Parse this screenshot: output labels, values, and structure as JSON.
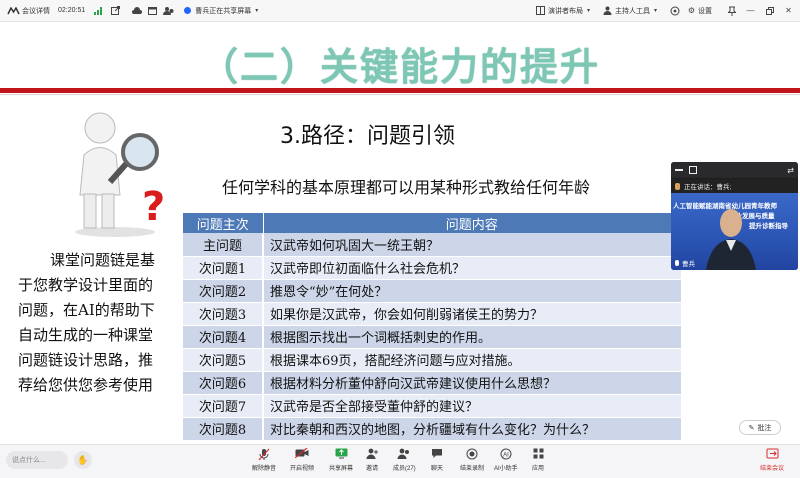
{
  "topbar": {
    "app_logo_label": "会议详情",
    "timer": "02:20:51",
    "sharing_label": "曹兵正在共享屏幕",
    "presenter_layout": "演讲者布局",
    "host_tools": "主持人工具",
    "settings": "设置"
  },
  "slide": {
    "title": "（二）关键能力的提升",
    "subtitle": "3.路径：问题引领",
    "lead": "任何学科的基本原理都可以用某种形式教给任何年龄",
    "side_text": "课堂问题链是基于您教学设计里面的问题，在AI的帮助下自动生成的一种课堂问题链设计思路，推荐给您供您参考使用",
    "table": {
      "headers": [
        "问题主次",
        "问题内容"
      ],
      "rows": [
        {
          "level": "主问题",
          "content": "汉武帝如何巩固大一统王朝？"
        },
        {
          "level": "次问题1",
          "content": "汉武帝即位初面临什么社会危机？"
        },
        {
          "level": "次问题2",
          "content": "推恩令“妙”在何处？"
        },
        {
          "level": "次问题3",
          "content": "如果你是汉武帝，你会如何削弱诸侯王的势力？"
        },
        {
          "level": "次问题4",
          "content": "根据图示找出一个词概括刺史的作用。"
        },
        {
          "level": "次问题5",
          "content": "根据课本69页，搭配经济问题与应对措施。"
        },
        {
          "level": "次问题6",
          "content": "根据材料分析董仲舒向汉武帝建议使用什么思想？"
        },
        {
          "level": "次问题7",
          "content": "汉武帝是否全部接受董仲舒的建议？"
        },
        {
          "level": "次问题8",
          "content": "对比秦朝和西汉的地图，分析疆域有什么变化？为什么？"
        }
      ]
    }
  },
  "video": {
    "status": "正在讲话：曹兵;",
    "banner1": "人工智能赋能湖南省幼儿园青年教师",
    "banner2": "专业发展与质量",
    "banner3": "提升诊断指导",
    "name": "曹兵"
  },
  "annotate": "批注",
  "bottombar": {
    "chat_placeholder": "说点什么...",
    "tools": [
      "解除静音",
      "开启视频",
      "共享屏幕",
      "邀请",
      "成员(27)",
      "聊天",
      "结束录制",
      "AI小助手",
      "应用"
    ],
    "end_label": "结束会议"
  },
  "colors": {
    "title_green": "#7fc7b5",
    "band_red": "#c0151c",
    "table_header": "#4d79b6",
    "row_odd": "#cdd6e9",
    "row_even": "#e7ecf6",
    "end_red": "#d92b2b"
  }
}
